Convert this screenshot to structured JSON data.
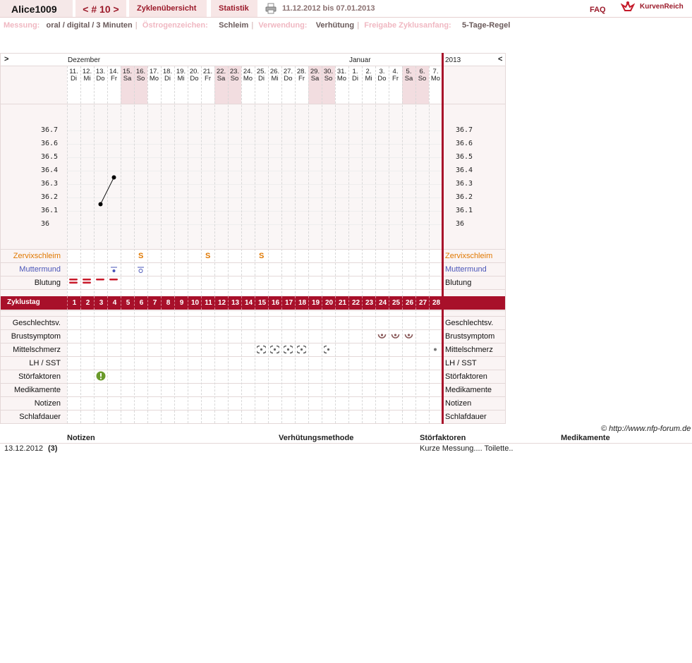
{
  "header": {
    "username": "Alice1009",
    "cycle_label": "< # 10 >",
    "tab_overview": "Zyklenübersicht",
    "tab_stats": "Statistik",
    "date_range": "11.12.2012 bis 07.01.2013",
    "faq": "FAQ",
    "logo": "KurvenReich"
  },
  "settings": {
    "measurement_label": "Messung:",
    "measurement_value": "oral / digital / 3 Minuten",
    "estrogen_label": "Östrogenzeichen:",
    "estrogen_value": "Schleim",
    "usage_label": "Verwendung:",
    "usage_value": "Verhütung",
    "release_label": "Freigabe Zyklusanfang:",
    "release_value": "5-Tage-Regel"
  },
  "chart": {
    "nav_left": ">",
    "nav_right": "<",
    "month_dec": "Dezember",
    "month_jan": "Januar",
    "year": "2013",
    "days": [
      {
        "d": "11.",
        "w": "Di",
        "we": false
      },
      {
        "d": "12.",
        "w": "Mi",
        "we": false
      },
      {
        "d": "13.",
        "w": "Do",
        "we": false
      },
      {
        "d": "14.",
        "w": "Fr",
        "we": false
      },
      {
        "d": "15.",
        "w": "Sa",
        "we": true
      },
      {
        "d": "16.",
        "w": "So",
        "we": true
      },
      {
        "d": "17.",
        "w": "Mo",
        "we": false
      },
      {
        "d": "18.",
        "w": "Di",
        "we": false
      },
      {
        "d": "19.",
        "w": "Mi",
        "we": false
      },
      {
        "d": "20.",
        "w": "Do",
        "we": false
      },
      {
        "d": "21.",
        "w": "Fr",
        "we": false
      },
      {
        "d": "22.",
        "w": "Sa",
        "we": true
      },
      {
        "d": "23.",
        "w": "So",
        "we": true
      },
      {
        "d": "24.",
        "w": "Mo",
        "we": false
      },
      {
        "d": "25.",
        "w": "Di",
        "we": false
      },
      {
        "d": "26.",
        "w": "Mi",
        "we": false
      },
      {
        "d": "27.",
        "w": "Do",
        "we": false
      },
      {
        "d": "28.",
        "w": "Fr",
        "we": false
      },
      {
        "d": "29.",
        "w": "Sa",
        "we": true
      },
      {
        "d": "30.",
        "w": "So",
        "we": true
      },
      {
        "d": "31.",
        "w": "Mo",
        "we": false
      },
      {
        "d": "1.",
        "w": "Di",
        "we": false
      },
      {
        "d": "2.",
        "w": "Mi",
        "we": false
      },
      {
        "d": "3.",
        "w": "Do",
        "we": false
      },
      {
        "d": "4.",
        "w": "Fr",
        "we": false
      },
      {
        "d": "5.",
        "w": "Sa",
        "we": true
      },
      {
        "d": "6.",
        "w": "So",
        "we": true
      },
      {
        "d": "7.",
        "w": "Mo",
        "we": false
      }
    ],
    "temp_ticks": [
      "36.7",
      "36.6",
      "36.5",
      "36.4",
      "36.3",
      "36.2",
      "36.1",
      "36"
    ],
    "temperatures": [
      {
        "day": 3,
        "value": 36.15
      },
      {
        "day": 4,
        "value": 36.35
      }
    ],
    "rows": {
      "cervical": "Zervixschleim",
      "cervix": "Muttermund",
      "bleeding": "Blutung",
      "cycle_day": "Zyklustag",
      "intercourse": "Geschlechtsv.",
      "breast": "Brustsymptom",
      "midpain": "Mittelschmerz",
      "lh": "LH / SST",
      "disturbance": "Störfaktoren",
      "medication": "Medikamente",
      "notes": "Notizen",
      "sleep": "Schlafdauer"
    },
    "cervical_marks": [
      {
        "day": 6,
        "v": "S"
      },
      {
        "day": 11,
        "v": "S"
      },
      {
        "day": 15,
        "v": "S"
      }
    ],
    "bleeding_days": [
      1,
      2,
      3,
      4
    ],
    "breast_days": [
      24,
      25,
      26
    ],
    "midpain_days": [
      15,
      16,
      17,
      18
    ],
    "cycle_numbers": [
      "1",
      "2",
      "3",
      "4",
      "5",
      "6",
      "7",
      "8",
      "9",
      "10",
      "11",
      "12",
      "13",
      "14",
      "15",
      "16",
      "17",
      "18",
      "19",
      "20",
      "21",
      "22",
      "23",
      "24",
      "25",
      "26",
      "27",
      "28"
    ],
    "colors": {
      "accent": "#a8102a",
      "weekend": "#f2dde0",
      "cervical": "#e07800",
      "cervix": "#4a55b8"
    }
  },
  "copyright": "© http://www.nfp-forum.de",
  "notes_table": {
    "headers": [
      "Notizen",
      "Verhütungsmethode",
      "Störfaktoren",
      "Medikamente"
    ],
    "rows": [
      {
        "date": "13.12.2012",
        "count": "(3)",
        "notes": "",
        "method": "",
        "disturbance": "Kurze Messung.... Toilette..",
        "meds": ""
      }
    ]
  }
}
